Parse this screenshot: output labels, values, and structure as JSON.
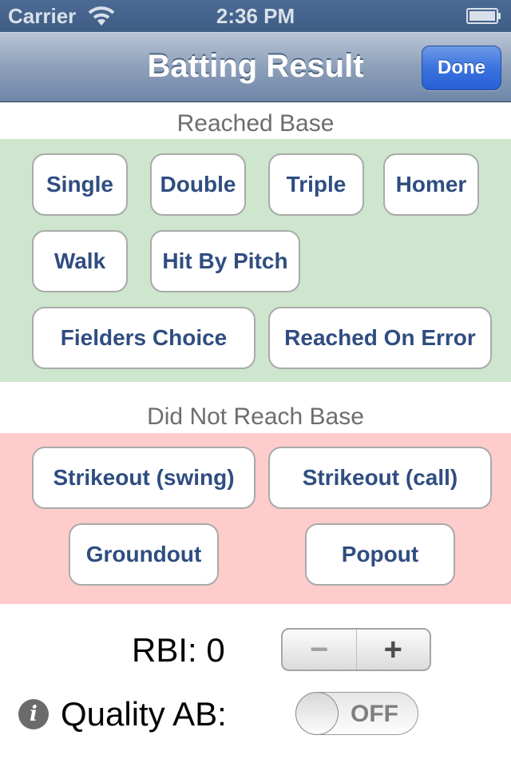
{
  "status_bar": {
    "carrier": "Carrier",
    "time": "2:36 PM",
    "wifi_icon": "wifi-icon",
    "battery_icon": "battery-icon"
  },
  "nav": {
    "title": "Batting Result",
    "done_label": "Done"
  },
  "sections": {
    "reached": {
      "label": "Reached Base",
      "color": "#cde6cd",
      "buttons": [
        "Single",
        "Double",
        "Triple",
        "Homer",
        "Walk",
        "Hit By Pitch",
        "Fielders Choice",
        "Reached On Error"
      ]
    },
    "not_reached": {
      "label": "Did Not Reach Base",
      "color": "#ffcccc",
      "buttons": [
        "Strikeout (swing)",
        "Strikeout (call)",
        "Groundout",
        "Popout"
      ]
    }
  },
  "rbi": {
    "label": "RBI: 0",
    "value": 0,
    "minus": "−",
    "plus": "+"
  },
  "quality_ab": {
    "info_icon": "i",
    "label": "Quality AB:",
    "state": "OFF",
    "on": false
  },
  "colors": {
    "button_text": "#2f4d80",
    "done_button": "#2f6ad9"
  }
}
